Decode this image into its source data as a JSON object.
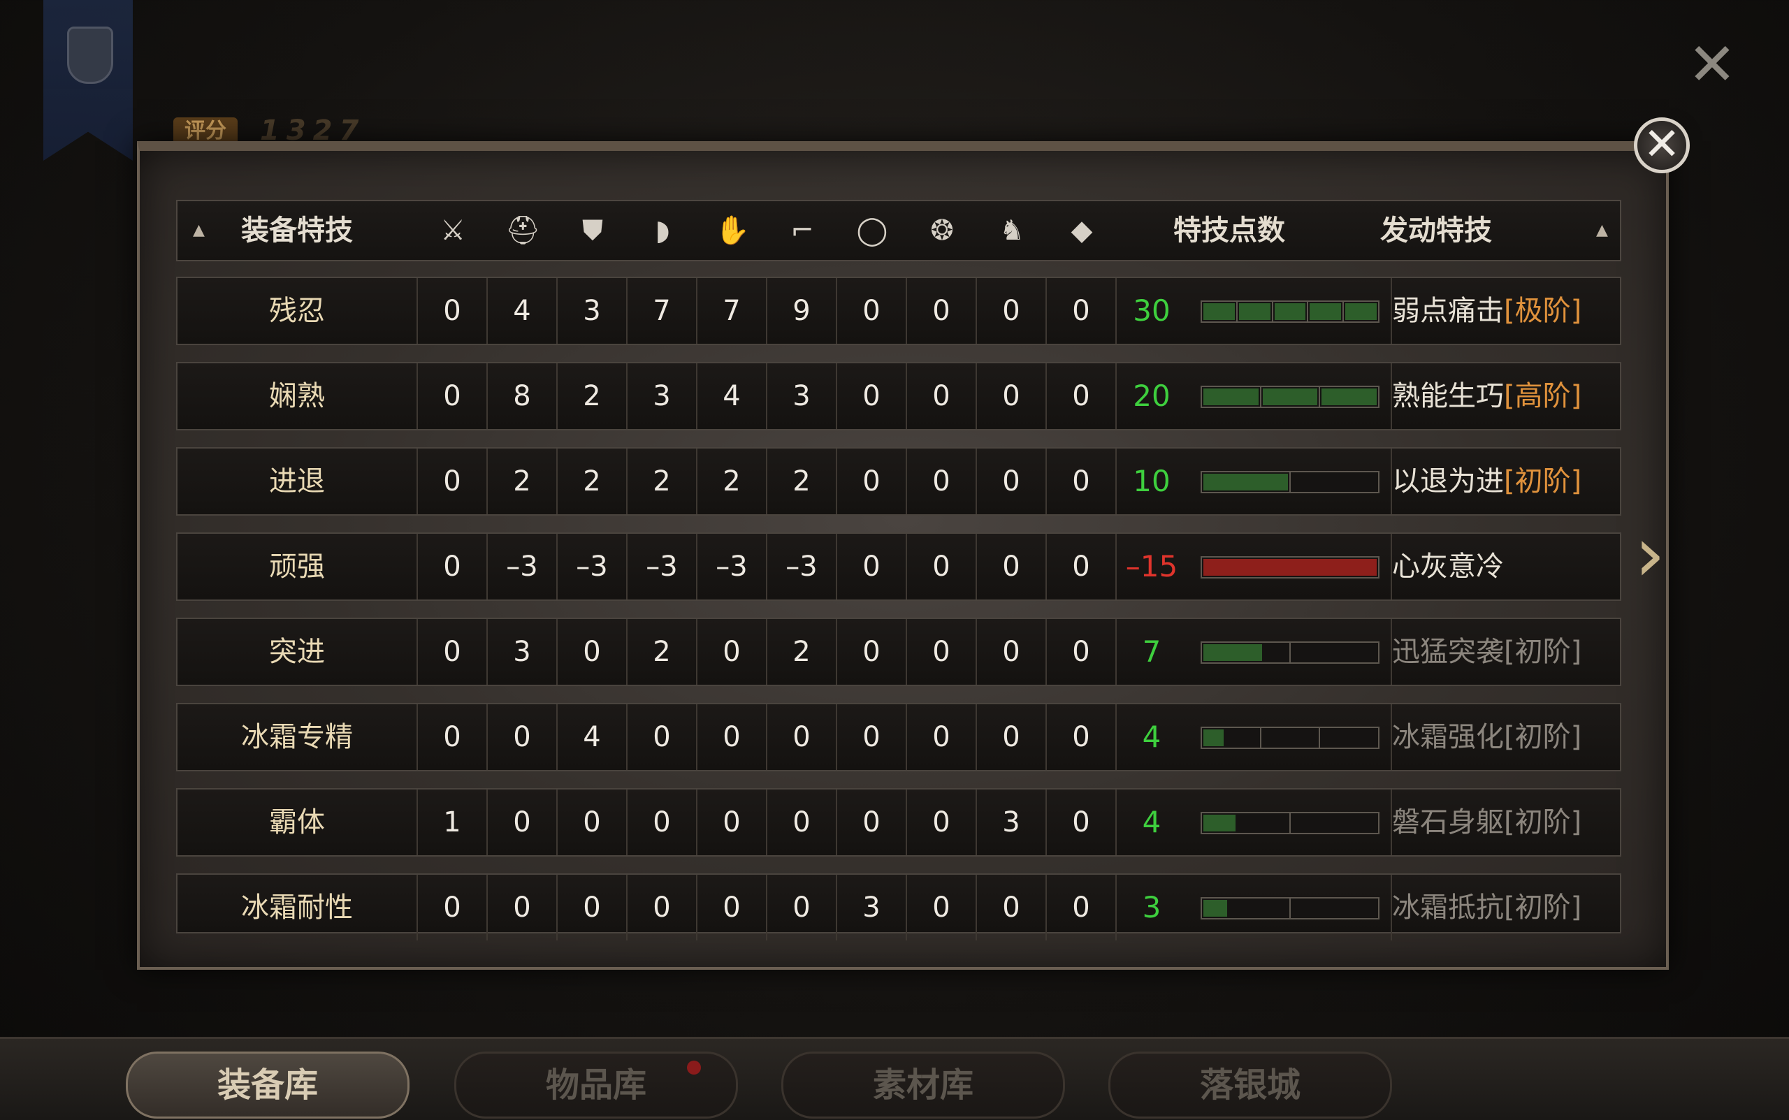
{
  "background": {
    "score_label": "评分",
    "score_value": "1327"
  },
  "header": {
    "title": "装备特技",
    "points_label": "特技点数",
    "active_label": "发动特技",
    "slot_icons": [
      "sword-icon",
      "helmet-icon",
      "chest-armor-icon",
      "shoulder-icon",
      "glove-icon",
      "boot-icon",
      "ring-icon",
      "amulet-icon",
      "horse-icon",
      "gem-icon"
    ]
  },
  "rows": [
    {
      "name": "残忍",
      "values": [
        "0",
        "4",
        "3",
        "7",
        "7",
        "9",
        "0",
        "0",
        "0",
        "0"
      ],
      "points": "30",
      "points_color": "#3ecf3e",
      "segments": 5,
      "filled": 5,
      "fill_color": "#2d5e2a",
      "skill": "弱点痛击",
      "tier": "[极阶]",
      "active": true
    },
    {
      "name": "娴熟",
      "values": [
        "0",
        "8",
        "2",
        "3",
        "4",
        "3",
        "0",
        "0",
        "0",
        "0"
      ],
      "points": "20",
      "points_color": "#3ecf3e",
      "segments": 3,
      "filled": 3,
      "fill_color": "#2d5e2a",
      "skill": "熟能生巧",
      "tier": "[高阶]",
      "active": true
    },
    {
      "name": "进退",
      "values": [
        "0",
        "2",
        "2",
        "2",
        "2",
        "2",
        "0",
        "0",
        "0",
        "0"
      ],
      "points": "10",
      "points_color": "#3ecf3e",
      "segments": 2,
      "filled": 1,
      "fill_color": "#2d5e2a",
      "skill": "以退为进",
      "tier": "[初阶]",
      "active": true
    },
    {
      "name": "顽强",
      "values": [
        "0",
        "–3",
        "–3",
        "–3",
        "–3",
        "–3",
        "0",
        "0",
        "0",
        "0"
      ],
      "points": "–15",
      "points_color": "#e0342c",
      "segments": 1,
      "filled": 1,
      "fill_color": "#8e1f1b",
      "skill": "心灰意冷",
      "tier": "",
      "active": true
    },
    {
      "name": "突进",
      "values": [
        "0",
        "3",
        "0",
        "2",
        "0",
        "2",
        "0",
        "0",
        "0",
        "0"
      ],
      "points": "7",
      "points_color": "#3ecf3e",
      "segments": 2,
      "filled": 0.7,
      "fill_color": "#2d5e2a",
      "skill": "迅猛突袭",
      "tier": "[初阶]",
      "active": false
    },
    {
      "name": "冰霜专精",
      "values": [
        "0",
        "0",
        "4",
        "0",
        "0",
        "0",
        "0",
        "0",
        "0",
        "0"
      ],
      "points": "4",
      "points_color": "#3ecf3e",
      "segments": 3,
      "filled": 0.4,
      "fill_color": "#2d5e2a",
      "skill": "冰霜强化",
      "tier": "[初阶]",
      "active": false
    },
    {
      "name": "霸体",
      "values": [
        "1",
        "0",
        "0",
        "0",
        "0",
        "0",
        "0",
        "0",
        "3",
        "0"
      ],
      "points": "4",
      "points_color": "#3ecf3e",
      "segments": 2,
      "filled": 0.4,
      "fill_color": "#2d5e2a",
      "skill": "磐石身躯",
      "tier": "[初阶]",
      "active": false
    },
    {
      "name": "冰霜耐性",
      "values": [
        "0",
        "0",
        "0",
        "0",
        "0",
        "0",
        "3",
        "0",
        "0",
        "0"
      ],
      "points": "3",
      "points_color": "#3ecf3e",
      "segments": 2,
      "filled": 0.3,
      "fill_color": "#2d5e2a",
      "skill": "冰霜抵抗",
      "tier": "[初阶]",
      "active": false
    }
  ],
  "tabs": [
    {
      "label": "装备库",
      "active": true
    },
    {
      "label": "物品库",
      "active": false
    },
    {
      "label": "素材库",
      "active": false
    },
    {
      "label": "落银城",
      "active": false
    }
  ]
}
